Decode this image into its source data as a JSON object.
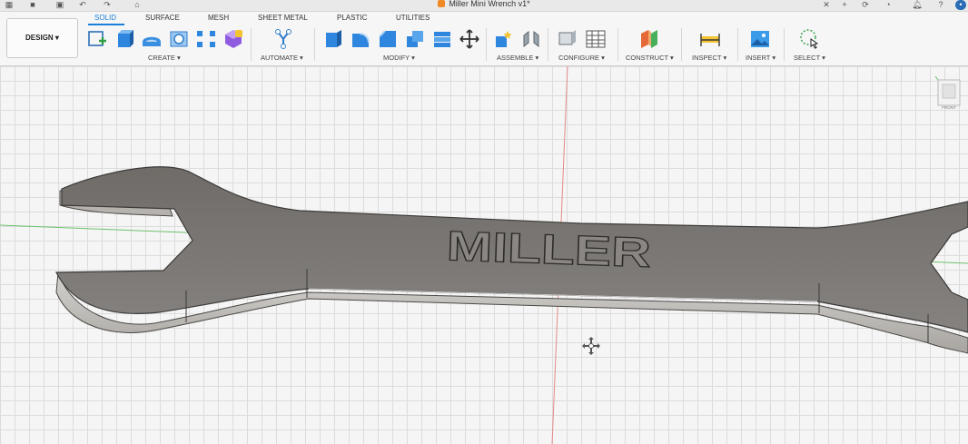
{
  "window": {
    "title": "Miller Mini Wrench v1*"
  },
  "workspace": {
    "label": "DESIGN ▾"
  },
  "tabs": [
    {
      "label": "SOLID"
    },
    {
      "label": "SURFACE"
    },
    {
      "label": "MESH"
    },
    {
      "label": "SHEET METAL"
    },
    {
      "label": "PLASTIC"
    },
    {
      "label": "UTILITIES"
    }
  ],
  "groups": [
    {
      "label": "CREATE ▾"
    },
    {
      "label": "AUTOMATE ▾"
    },
    {
      "label": "MODIFY ▾"
    },
    {
      "label": "ASSEMBLE ▾"
    },
    {
      "label": "CONFIGURE ▾"
    },
    {
      "label": "CONSTRUCT ▾"
    },
    {
      "label": "INSPECT ▾"
    },
    {
      "label": "INSERT ▾"
    },
    {
      "label": "SELECT ▾"
    }
  ],
  "model": {
    "engraved_text": "MILLER"
  },
  "viewcube": {
    "face_label": "FRONT"
  },
  "colors": {
    "accent": "#1b7fd8",
    "model_top": "#7b7874",
    "model_side": "#b8b5b0"
  },
  "icons": [
    "grid-icon",
    "file-icon",
    "save-icon",
    "undo-icon",
    "redo-icon",
    "home-icon",
    "add-icon",
    "refresh-icon",
    "job-status-icon",
    "notifications-icon",
    "help-icon",
    "avatar-icon"
  ]
}
